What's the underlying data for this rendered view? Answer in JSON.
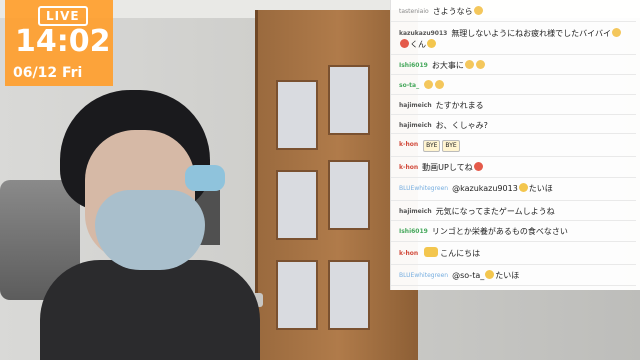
{
  "overlay": {
    "live_label": "LIVE",
    "time": "14:02",
    "date": "06/12 Fri",
    "badge_color": "#ff9e2c"
  },
  "chat": {
    "messages": [
      {
        "user": "tasteniaio",
        "user_color": "gray",
        "segments": [
          {
            "text": "さようなら"
          },
          {
            "emoji": "hand"
          }
        ]
      },
      {
        "user": "kazukazu9013",
        "user_color": "darkgray",
        "segments": [
          {
            "text": "無理しないようにねお疲れ様でしたバイバイ"
          },
          {
            "emoji": "hand"
          },
          {
            "emoji": "red"
          },
          {
            "text": "くん"
          },
          {
            "emoji": "face"
          }
        ]
      },
      {
        "user": "Ishi6019",
        "user_color": "green",
        "segments": [
          {
            "text": "お大事に"
          },
          {
            "emoji": "hand"
          },
          {
            "emoji": "hand"
          }
        ]
      },
      {
        "user": "so-ta_",
        "user_color": "green",
        "segments": [
          {
            "emoji": "hand"
          },
          {
            "emoji": "hand"
          }
        ]
      },
      {
        "user": "hajimeich",
        "user_color": "darkgray",
        "segments": [
          {
            "text": "たすかれまる"
          }
        ]
      },
      {
        "user": "hajimeich",
        "user_color": "darkgray",
        "segments": [
          {
            "text": "お、くしゃみ?"
          }
        ]
      },
      {
        "user": "k-hon",
        "user_color": "red",
        "segments": [
          {
            "sticker": "BYE"
          },
          {
            "sticker": "BYE"
          }
        ]
      },
      {
        "user": "k-hon",
        "user_color": "red",
        "segments": [
          {
            "text": "動画UPしてね"
          },
          {
            "emoji": "red"
          }
        ]
      },
      {
        "user": "BLUEwhitegreen",
        "user_color": "blue",
        "segments": [
          {
            "text": "@kazukazu9013"
          },
          {
            "emoji": "face"
          },
          {
            "text": "たいほ"
          }
        ]
      },
      {
        "user": "hajimeich",
        "user_color": "darkgray",
        "segments": [
          {
            "text": "元気になってまたゲームしようね"
          }
        ]
      },
      {
        "user": "Ishi6019",
        "user_color": "green",
        "segments": [
          {
            "text": "リンゴとか栄養があるもの食べなさい"
          }
        ]
      },
      {
        "user": "k-hon",
        "user_color": "red",
        "segments": [
          {
            "sticker": ""
          },
          {
            "text": "こんにちは"
          }
        ]
      },
      {
        "user": "BLUEwhitegreen",
        "user_color": "blue",
        "segments": [
          {
            "text": "@so-ta_"
          },
          {
            "emoji": "face"
          },
          {
            "text": "たいほ"
          }
        ]
      }
    ]
  }
}
